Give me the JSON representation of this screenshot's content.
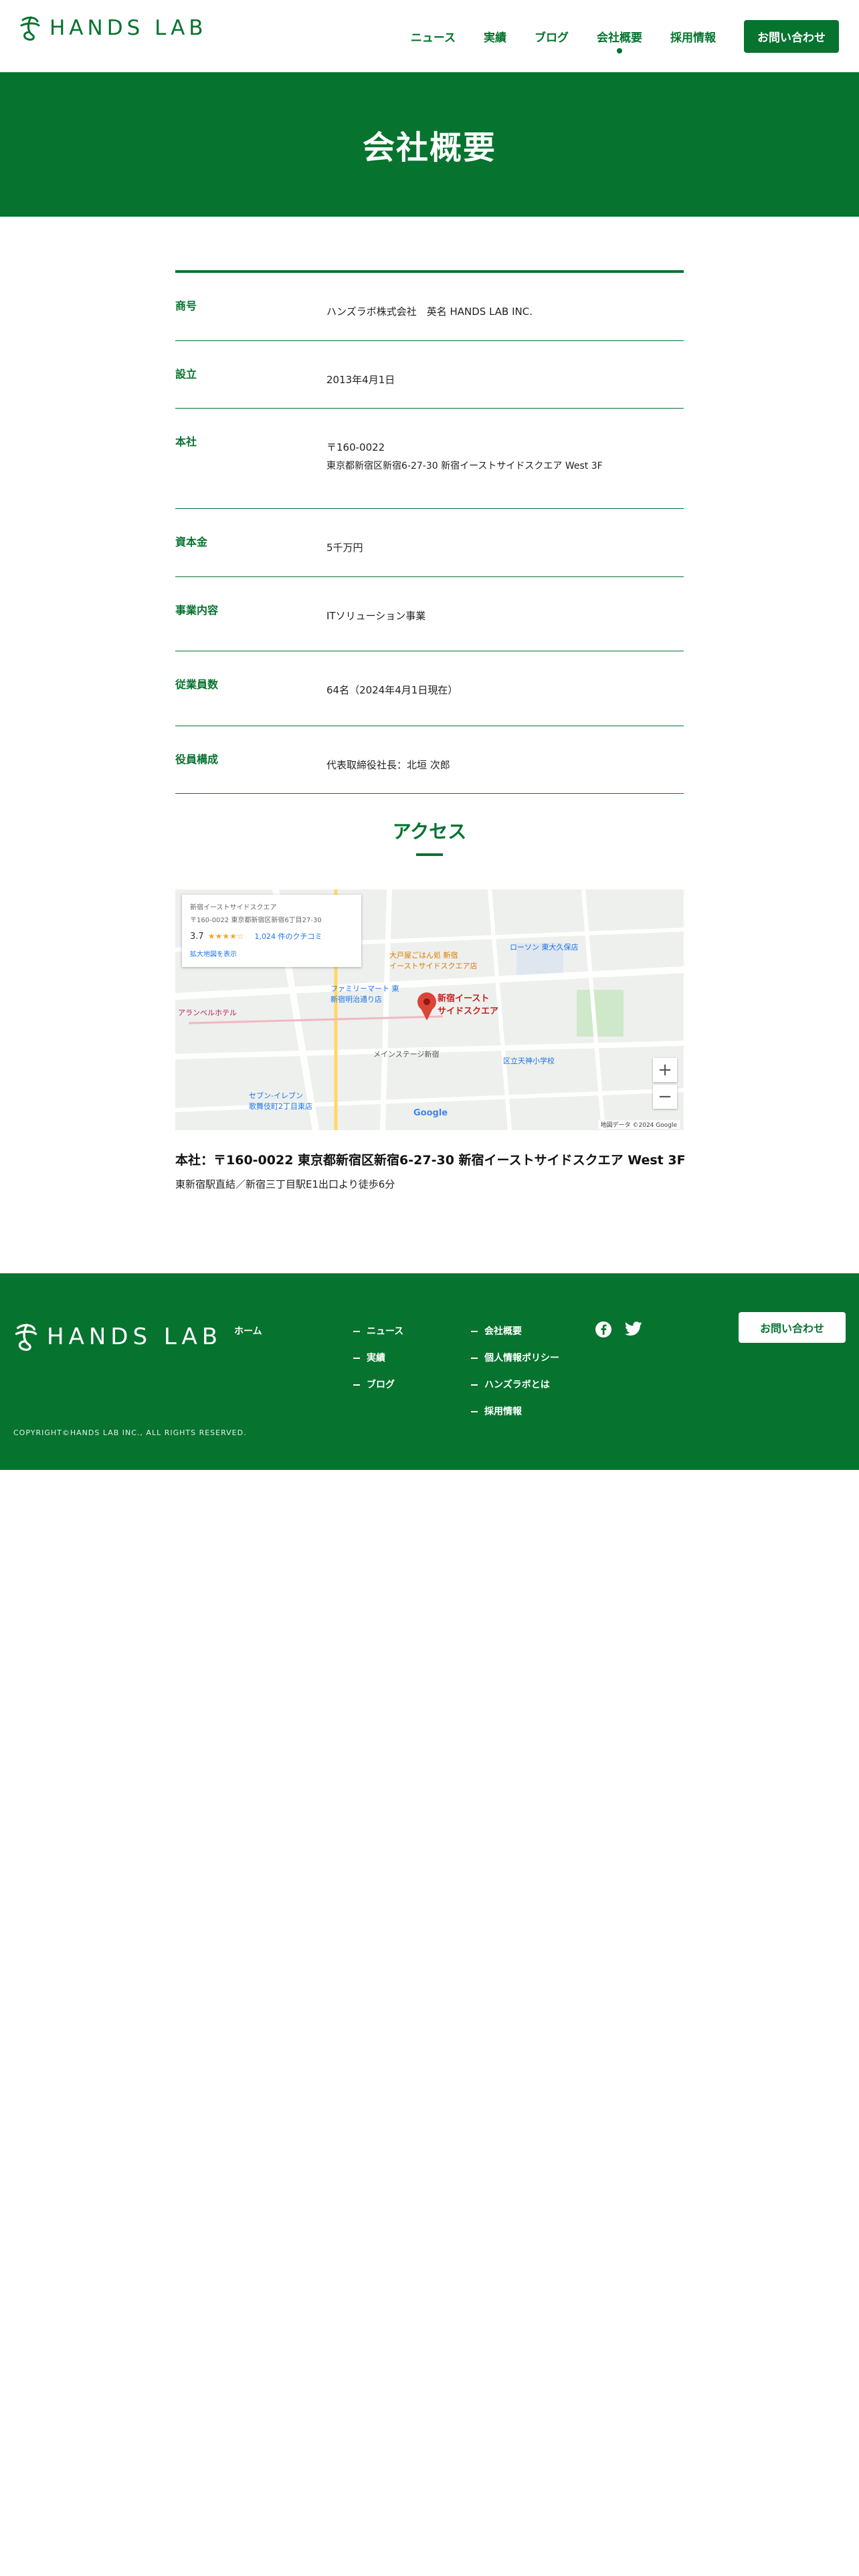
{
  "header": {
    "logo_text": "HANDS LAB",
    "nav": [
      {
        "label": "ニュース",
        "active": false
      },
      {
        "label": "実績",
        "active": false
      },
      {
        "label": "ブログ",
        "active": false
      },
      {
        "label": "会社概要",
        "active": true
      },
      {
        "label": "採用情報",
        "active": false
      }
    ],
    "contact_label": "お問い合わせ"
  },
  "hero": {
    "title": "会社概要"
  },
  "company": {
    "rows": [
      {
        "label": "商号",
        "lines": [
          "ハンズラボ株式会社　英名 HANDS LAB INC."
        ]
      },
      {
        "label": "設立",
        "lines": [
          "2013年4月1日"
        ]
      },
      {
        "label": "本社",
        "lines": [
          "〒160-0022",
          "東京都新宿区新宿6-27-30 新宿イーストサイドスクエア West 3F"
        ]
      },
      {
        "label": "資本金",
        "lines": [
          "5千万円"
        ]
      },
      {
        "label": "事業内容",
        "lines": [
          "ITソリューション事業"
        ]
      },
      {
        "label": "従業員数",
        "lines": [
          "64名（2024年4月1日現在）"
        ]
      },
      {
        "label": "役員構成",
        "lines": [
          "代表取締役社長：北垣 次郎"
        ]
      }
    ]
  },
  "access": {
    "title": "アクセス",
    "map": {
      "card_line1": "新宿イーストサイドスクエア",
      "card_line2": "〒160-0022 東京都新宿区新宿6丁目27-30",
      "rating": "3.7",
      "stars": "★★★★☆",
      "reviews": "1,024 件のクチコミ",
      "larger_map": "拡大地図を表示",
      "labels": {
        "pin": "新宿イースト\nサイドスクエア",
        "ootoya": "大戸屋ごはん処 新宿\nイーストサイドスクエア店",
        "lawson": "ローソン 東大久保店",
        "familymart": "ファミリーマート 東\n新宿明治通り店",
        "seven": "セブン-イレブン\n歌舞伎町2丁目東店",
        "hotel": "アランベルホテル",
        "school": "区立天神小学校",
        "stage": "メインステージ新宿",
        "google": "Google",
        "copyright": "地図データ ©2024 Google"
      }
    },
    "address_main": "本社：〒160-0022 東京都新宿区新宿6-27-30 新宿イーストサイドスクエア West 3F",
    "address_sub": "東新宿駅直結／新宿三丁目駅E1出口より徒歩6分"
  },
  "footer": {
    "logo_text": "HANDS LAB",
    "home": "ホーム",
    "col2": [
      "ニュース",
      "実績",
      "ブログ"
    ],
    "col3": [
      "会社概要",
      "個人情報ポリシー",
      "ハンズラボとは",
      "採用情報"
    ],
    "contact_label": "お問い合わせ",
    "copyright": "COPYRIGHT©HANDS LAB INC., ALL RIGHTS RESERVED."
  },
  "colors": {
    "brand": "#06732f"
  }
}
